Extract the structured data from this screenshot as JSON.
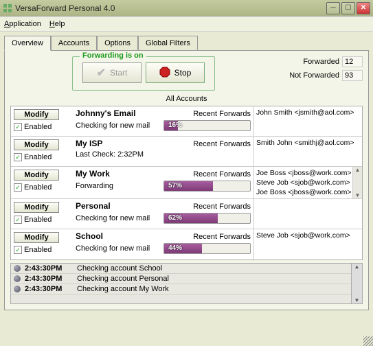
{
  "window": {
    "title": "VersaForward Personal 4.0"
  },
  "menu": {
    "application": "Application",
    "help": "Help"
  },
  "tabs": [
    "Overview",
    "Accounts",
    "Options",
    "Global Filters"
  ],
  "forwarding": {
    "legend": "Forwarding is on",
    "start": "Start",
    "stop": "Stop"
  },
  "stats": {
    "forwarded_label": "Forwarded",
    "forwarded_value": "12",
    "notforwarded_label": "Not Forwarded",
    "notforwarded_value": "93"
  },
  "all_accounts_label": "All Accounts",
  "labels": {
    "modify": "Modify",
    "enabled": "Enabled",
    "recent": "Recent Forwards"
  },
  "accounts": [
    {
      "name": "Johnny's Email",
      "status": "Checking for new mail",
      "progress": "16%",
      "progress_w": "16%",
      "forwards": [
        "John Smith <jsmith@aol.com>"
      ],
      "has_progress": true
    },
    {
      "name": "My ISP",
      "status": "Last Check: 2:32PM",
      "forwards": [
        "Smith John <smithj@aol.com>"
      ],
      "has_progress": false
    },
    {
      "name": "My Work",
      "status": "Forwarding",
      "progress": "57%",
      "progress_w": "57%",
      "forwards": [
        "Joe Boss <jboss@work.com>",
        "Steve Job <sjob@work.com>",
        "Joe Boss <jboss@work.com>"
      ],
      "has_progress": true,
      "scrollable": true
    },
    {
      "name": "Personal",
      "status": "Checking for new mail",
      "progress": "62%",
      "progress_w": "62%",
      "forwards": [],
      "has_progress": true
    },
    {
      "name": "School",
      "status": "Checking for new mail",
      "progress": "44%",
      "progress_w": "44%",
      "forwards": [
        "Steve Job <sjob@work.com>"
      ],
      "has_progress": true
    }
  ],
  "log": [
    {
      "time": "2:43:30PM",
      "msg": "Checking account School"
    },
    {
      "time": "2:43:30PM",
      "msg": "Checking account Personal"
    },
    {
      "time": "2:43:30PM",
      "msg": "Checking account My Work"
    }
  ]
}
